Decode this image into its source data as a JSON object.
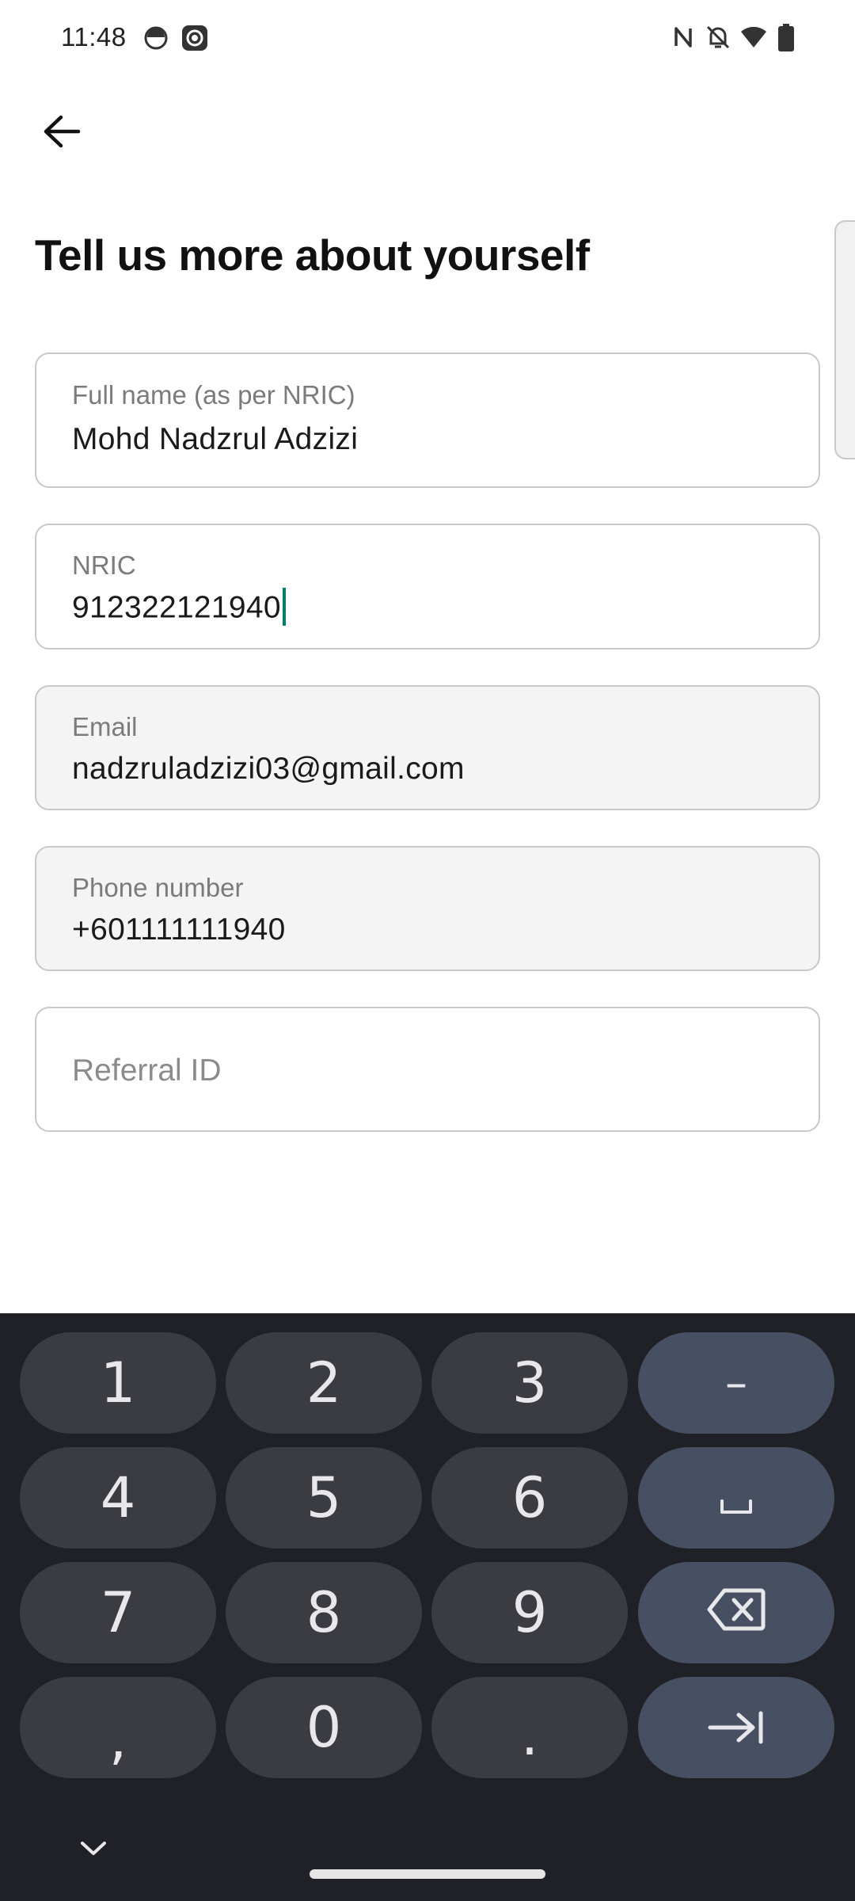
{
  "status_bar": {
    "time": "11:48",
    "left_icons": [
      "android-face-icon",
      "screen-record-icon"
    ],
    "right_icons": [
      "nfc-icon",
      "bell-off-icon",
      "wifi-icon",
      "battery-icon"
    ]
  },
  "header": {
    "back_icon": "arrow-left-icon",
    "title": "Tell us more about yourself"
  },
  "form": {
    "full_name": {
      "label": "Full name (as per NRIC)",
      "value": "Mohd Nadzrul Adzizi"
    },
    "nric": {
      "label": "NRIC",
      "value": "912322121940"
    },
    "email": {
      "label": "Email",
      "value": "nadzruladzizi03@gmail.com"
    },
    "phone": {
      "label": "Phone number",
      "value": "+601111111940"
    },
    "referral": {
      "placeholder": "Referral ID",
      "value": ""
    }
  },
  "keyboard": {
    "keys": {
      "k1": "1",
      "k2": "2",
      "k3": "3",
      "dash": "–",
      "k4": "4",
      "k5": "5",
      "k6": "6",
      "k7": "7",
      "k8": "8",
      "k9": "9",
      "comma": ",",
      "k0": "0",
      "period": "."
    },
    "icons": [
      "space-icon",
      "backspace-icon",
      "tab-next-icon",
      "chevron-down-icon"
    ]
  },
  "colors": {
    "caret": "#00806f",
    "keyboard_bg": "#202126",
    "key_bg": "#3b3c42",
    "func_key_bg": "#474f62"
  }
}
